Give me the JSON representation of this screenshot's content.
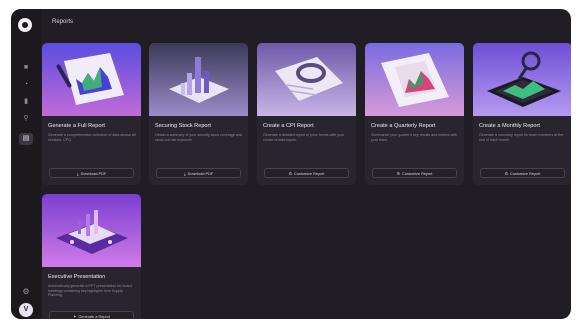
{
  "page": {
    "title": "Reports"
  },
  "sidebar": {
    "items": [
      {
        "icon": "home-icon",
        "glyph": "■"
      },
      {
        "icon": "chart-icon",
        "glyph": "◔"
      },
      {
        "icon": "bar-chart-icon",
        "glyph": "▮"
      },
      {
        "icon": "location-icon",
        "glyph": "⚲"
      },
      {
        "icon": "reports-icon",
        "glyph": "▤",
        "active": true
      }
    ],
    "settings_glyph": "⚙",
    "avatar_initial": "V"
  },
  "reports": [
    {
      "title": "Generate a Full Report",
      "description": "Generate a comprehensive collection of data across all sections. CPQ.",
      "button": "Download PDF",
      "colors": {
        "top": "#5b4de0",
        "bottom": "#c06bd8"
      }
    },
    {
      "title": "Securing Stock Report",
      "description": "Obtain a summary of your security stock coverage and stock-out risk exposure.",
      "button": "Download PDF",
      "colors": {
        "top": "#3c3a58",
        "bottom": "#9a8cc9"
      }
    },
    {
      "title": "Create a CPI Report",
      "description": "Generate a detailed report of price trends with your choice of data inputs.",
      "button": "Customize Report",
      "colors": {
        "top": "#6e5aa8",
        "bottom": "#c8b4e6"
      }
    },
    {
      "title": "Create a Quarterly Report",
      "description": "Summarize your quarter's key results and metrics with your team.",
      "button": "Customize Report",
      "colors": {
        "top": "#7a6be0",
        "bottom": "#d69ad8"
      }
    },
    {
      "title": "Create a Monthly Report",
      "description": "Generate a summary report for team members at the end of each month.",
      "button": "Customize Report",
      "colors": {
        "top": "#6e4fd8",
        "bottom": "#b59af0"
      }
    },
    {
      "title": "Executive Presentation",
      "description": "Automatically generate a PPT presentation for board meetings containing key highlights from Supply Planning.",
      "button": "Generate a Report",
      "colors": {
        "top": "#7a3fd0",
        "bottom": "#d17be8"
      }
    }
  ]
}
